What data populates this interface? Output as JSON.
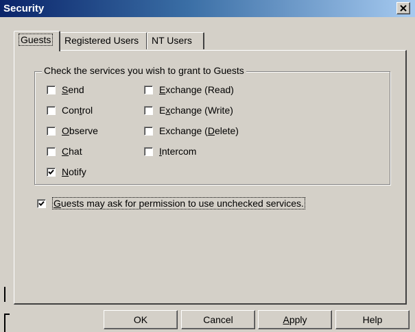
{
  "window": {
    "title": "Security"
  },
  "tabs": [
    {
      "label": "Guests",
      "active": true
    },
    {
      "label": "Registered Users",
      "active": false
    },
    {
      "label": "NT Users",
      "active": false
    }
  ],
  "group": {
    "legend": "Check the services you wish to grant to Guests",
    "left_column": [
      {
        "pre": "",
        "ul": "S",
        "post": "end",
        "checked": false
      },
      {
        "pre": "Con",
        "ul": "t",
        "post": "rol",
        "checked": false
      },
      {
        "pre": "",
        "ul": "O",
        "post": "bserve",
        "checked": false
      },
      {
        "pre": "",
        "ul": "C",
        "post": "hat",
        "checked": false
      },
      {
        "pre": "",
        "ul": "N",
        "post": "otify",
        "checked": true
      }
    ],
    "right_column": [
      {
        "pre": "",
        "ul": "E",
        "post": "xchange (Read)",
        "checked": false
      },
      {
        "pre": "E",
        "ul": "x",
        "post": "change (Write)",
        "checked": false
      },
      {
        "pre": "Exchange (",
        "ul": "D",
        "post": "elete)",
        "checked": false
      },
      {
        "pre": "",
        "ul": "I",
        "post": "ntercom",
        "checked": false
      }
    ]
  },
  "permission": {
    "pre": "",
    "ul": "G",
    "post": "uests may ask for permission to use unchecked services.",
    "checked": true
  },
  "buttons": {
    "ok": "OK",
    "cancel": "Cancel",
    "apply_ul": "A",
    "apply_rest": "pply",
    "help": "Help"
  }
}
